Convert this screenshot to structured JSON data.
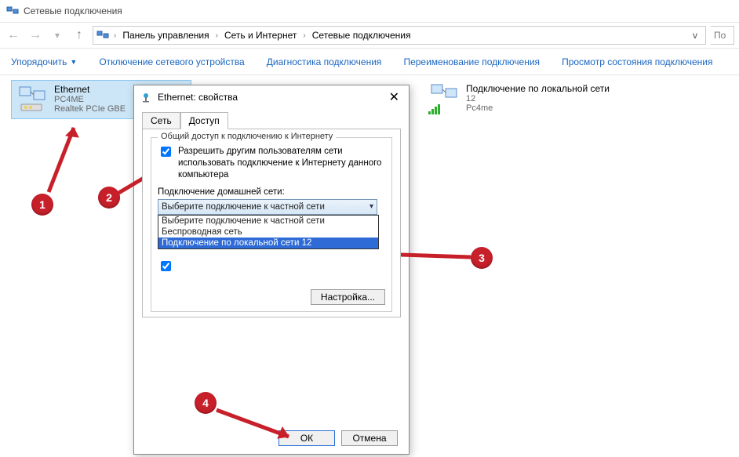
{
  "window": {
    "title": "Сетевые подключения"
  },
  "breadcrumb": {
    "items": [
      "Панель управления",
      "Сеть и Интернет",
      "Сетевые подключения"
    ]
  },
  "search": {
    "placeholder": "По"
  },
  "toolbar": {
    "organize": "Упорядочить",
    "disable": "Отключение сетевого устройства",
    "diagnose": "Диагностика подключения",
    "rename": "Переименование подключения",
    "status": "Просмотр состояния подключения"
  },
  "connections": {
    "ethernet": {
      "name": "Ethernet",
      "line2": "PC4ME",
      "line3": "Realtek PCIe GBE"
    },
    "local": {
      "name": "Подключение по локальной сети",
      "line2": "12",
      "line3": "Pc4me"
    }
  },
  "dialog": {
    "title": "Ethernet: свойства",
    "tabs": {
      "network": "Сеть",
      "access": "Доступ"
    },
    "group_title": "Общий доступ к подключению к Интернету",
    "chk_allow": "Разрешить другим пользователям сети использовать подключение к Интернету данного компьютера",
    "home_label": "Подключение домашней сети:",
    "combo_value": "Выберите подключение к частной сети",
    "combo_options": [
      "Выберите подключение к частной сети",
      "Беспроводная сеть",
      "Подключение по локальной сети 12"
    ],
    "settings_btn": "Настройка...",
    "ok": "ОК",
    "cancel": "Отмена"
  },
  "annotations": {
    "n1": "1",
    "n2": "2",
    "n3": "3",
    "n4": "4"
  }
}
